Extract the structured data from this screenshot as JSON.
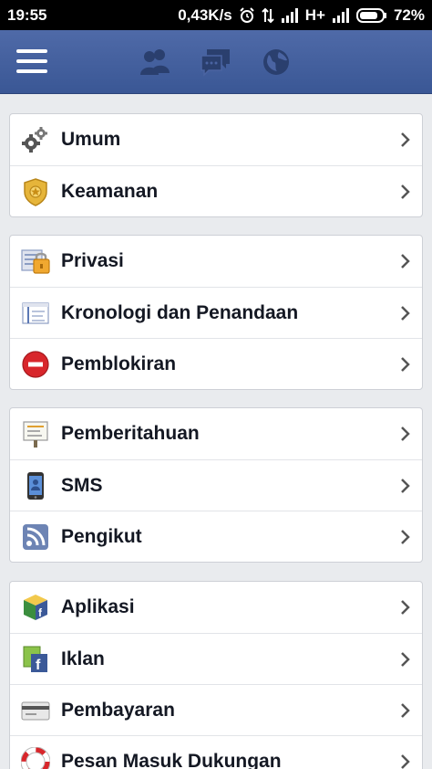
{
  "status": {
    "time": "19:55",
    "speed": "0,43K/s",
    "network": "H+",
    "battery": "72%"
  },
  "header": {
    "menu": "menu-icon",
    "icons": [
      "friends-icon",
      "messages-icon",
      "globe-icon"
    ]
  },
  "groups": [
    {
      "items": [
        {
          "label": "Umum",
          "icon": "gears-icon"
        },
        {
          "label": "Keamanan",
          "icon": "security-badge-icon"
        }
      ]
    },
    {
      "items": [
        {
          "label": "Privasi",
          "icon": "privacy-lock-icon"
        },
        {
          "label": "Kronologi dan Penandaan",
          "icon": "timeline-icon"
        },
        {
          "label": "Pemblokiran",
          "icon": "block-icon"
        }
      ]
    },
    {
      "items": [
        {
          "label": "Pemberitahuan",
          "icon": "notifications-board-icon"
        },
        {
          "label": "SMS",
          "icon": "phone-icon"
        },
        {
          "label": "Pengikut",
          "icon": "rss-icon"
        }
      ]
    },
    {
      "items": [
        {
          "label": "Aplikasi",
          "icon": "apps-cube-icon"
        },
        {
          "label": "Iklan",
          "icon": "ads-icon"
        },
        {
          "label": "Pembayaran",
          "icon": "card-icon"
        },
        {
          "label": "Pesan Masuk Dukungan",
          "icon": "lifebuoy-icon"
        }
      ]
    }
  ]
}
